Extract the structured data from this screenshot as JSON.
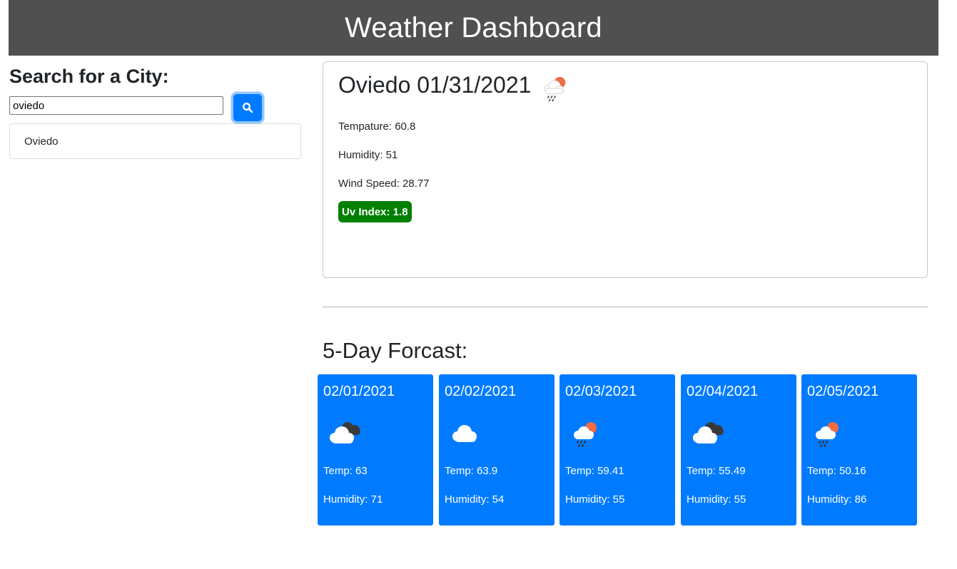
{
  "header": {
    "title": "Weather Dashboard"
  },
  "search": {
    "title": "Search for a City:",
    "input_value": "oviedo",
    "button_icon": "search-icon",
    "history": [
      {
        "label": "Oviedo"
      }
    ]
  },
  "current": {
    "heading": "Oviedo 01/31/2021",
    "icon": "rain-sun-icon",
    "temperature": "Tempature: 60.8",
    "humidity": "Humidity: 51",
    "wind": "Wind Speed: 28.77",
    "uv": "Uv Index: 1.8",
    "uv_color": "#008000"
  },
  "forecast": {
    "title": "5-Day Forcast:",
    "card_color": "#007bff",
    "days": [
      {
        "date": "02/01/2021",
        "icon": "broken-clouds-icon",
        "temp": "Temp: 63",
        "humidity": "Humidity: 71"
      },
      {
        "date": "02/02/2021",
        "icon": "cloud-icon",
        "temp": "Temp: 63.9",
        "humidity": "Humidity: 54"
      },
      {
        "date": "02/03/2021",
        "icon": "rain-sun-icon",
        "temp": "Temp: 59.41",
        "humidity": "Humidity: 55"
      },
      {
        "date": "02/04/2021",
        "icon": "broken-clouds-icon",
        "temp": "Temp: 55.49",
        "humidity": "Humidity: 55"
      },
      {
        "date": "02/05/2021",
        "icon": "rain-sun-icon",
        "temp": "Temp: 50.16",
        "humidity": "Humidity: 86"
      }
    ]
  }
}
